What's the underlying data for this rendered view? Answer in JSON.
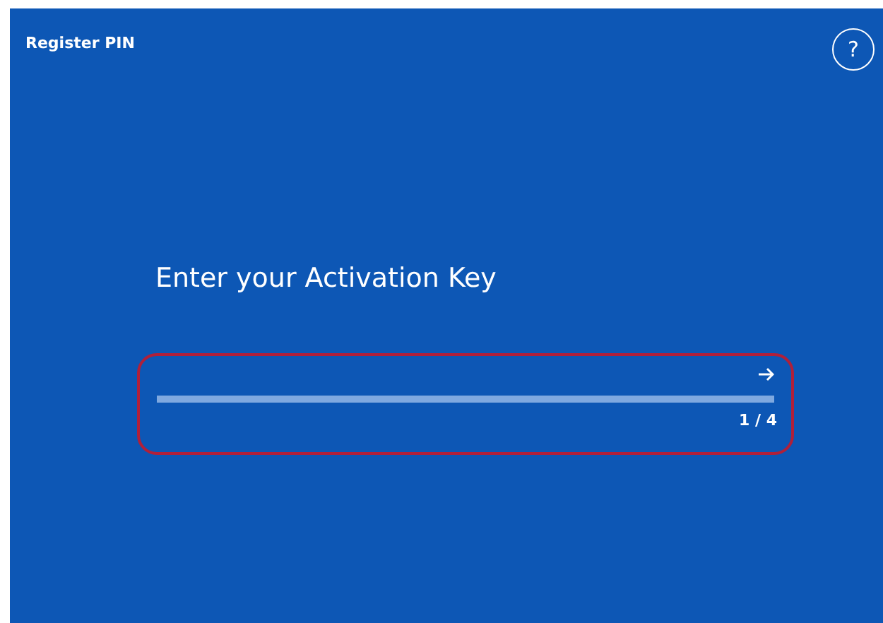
{
  "header": {
    "title": "Register PIN",
    "help_button": "?"
  },
  "prompt": {
    "heading": "Enter your Activation Key",
    "step": "1 / 4",
    "highlighted": true
  }
}
